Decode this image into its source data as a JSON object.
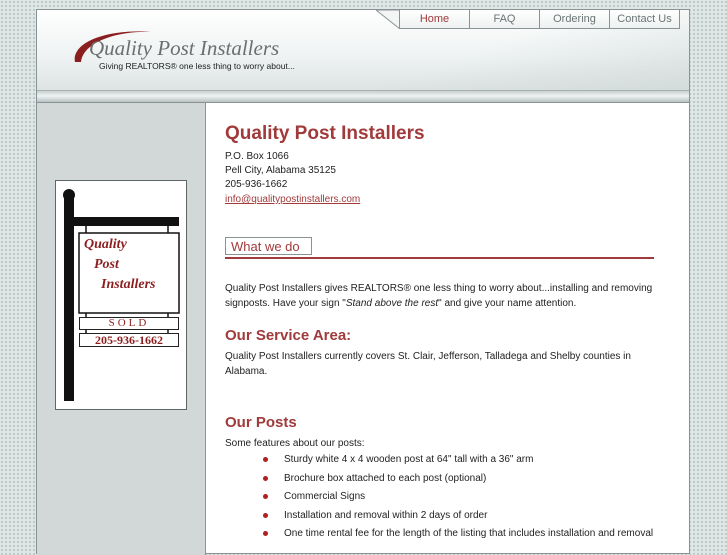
{
  "nav": {
    "items": [
      {
        "label": "Home",
        "active": true
      },
      {
        "label": "FAQ",
        "active": false
      },
      {
        "label": "Ordering",
        "active": false
      },
      {
        "label": "Contact Us",
        "active": false
      }
    ]
  },
  "logo": {
    "title": "Quality Post Installers",
    "tagline": "Giving REALTORS® one less thing to worry about..."
  },
  "sign": {
    "line1": "Quality",
    "line2": "Post",
    "line3": "Installers",
    "sold": "SOLD",
    "phone": "205-936-1662"
  },
  "content": {
    "title": "Quality Post Installers",
    "address": {
      "line1": "P.O. Box 1066",
      "line2": "Pell City, Alabama 35125",
      "phone": "205-936-1662",
      "email": "info@qualitypostinstallers.com"
    },
    "what_we_do": {
      "tab_label": "What we do",
      "text_before": "Quality Post Installers gives REALTORS® one less thing to worry about...installing and removing signposts.  Have your sign \"",
      "emphasis": "Stand above the rest",
      "text_after": "\" and give your name attention."
    },
    "service_area": {
      "heading": "Our Service Area:",
      "text": "Quality Post Installers currently covers St. Clair, Jefferson, Talladega and Shelby counties in Alabama."
    },
    "posts": {
      "heading": "Our Posts",
      "intro": "Some features about our posts:",
      "features": [
        "Sturdy white 4 x 4 wooden post at 64\" tall with a 36\" arm",
        "Brochure box attached to each post (optional)",
        "Commercial Signs",
        "Installation and removal within 2 days of order",
        "One time rental fee for the length of the listing that includes installation and removal"
      ]
    }
  },
  "colors": {
    "accent": "#a13a3a",
    "bullet": "#b02020",
    "sidebar": "#d2d8d8"
  }
}
